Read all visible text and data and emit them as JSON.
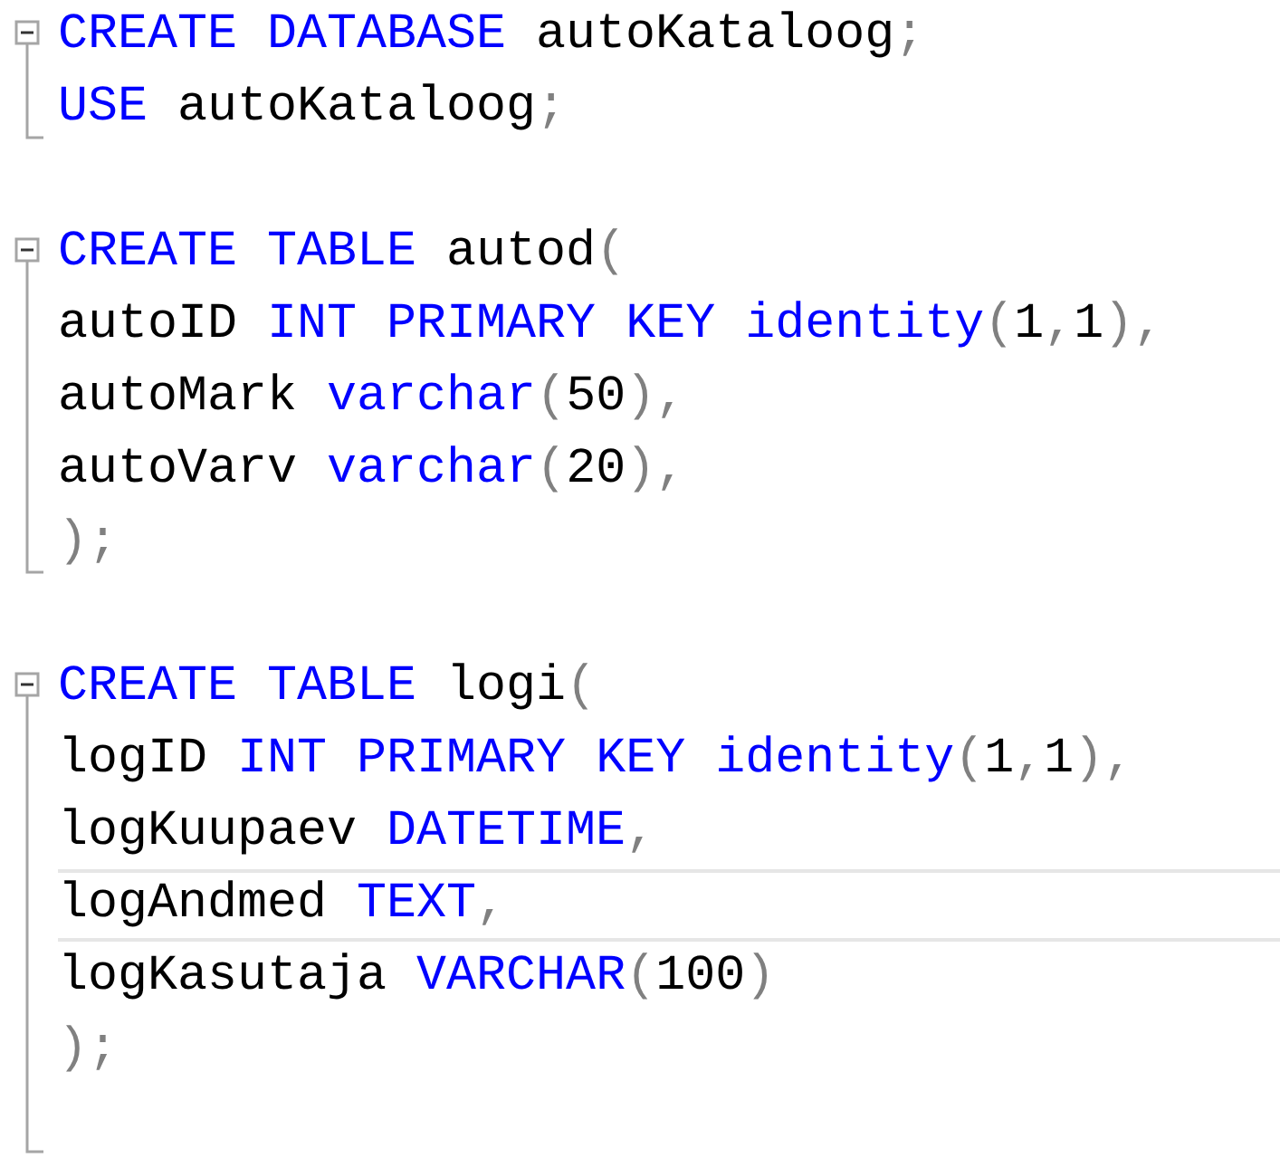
{
  "editor": {
    "lines": [
      {
        "kind": "start",
        "tokens": [
          {
            "text": "CREATE DATABASE",
            "kind": "keyword"
          },
          {
            "text": " autoKataloog",
            "kind": "ident"
          },
          {
            "text": ";",
            "kind": "punct"
          }
        ]
      },
      {
        "kind": "end",
        "tokens": [
          {
            "text": "USE",
            "kind": "keyword"
          },
          {
            "text": " autoKataloog",
            "kind": "ident"
          },
          {
            "text": ";",
            "kind": "punct"
          }
        ]
      },
      {
        "kind": "plain"
      },
      {
        "kind": "start",
        "tokens": [
          {
            "text": "CREATE TABLE",
            "kind": "keyword"
          },
          {
            "text": " autod",
            "kind": "ident"
          },
          {
            "text": "(",
            "kind": "punct"
          }
        ]
      },
      {
        "kind": "body",
        "tokens": [
          {
            "text": "autoID ",
            "kind": "ident"
          },
          {
            "text": "INT PRIMARY KEY identity",
            "kind": "keyword"
          },
          {
            "text": "(",
            "kind": "punct"
          },
          {
            "text": "1",
            "kind": "ident"
          },
          {
            "text": ",",
            "kind": "punct"
          },
          {
            "text": "1",
            "kind": "ident"
          },
          {
            "text": "),",
            "kind": "punct"
          }
        ]
      },
      {
        "kind": "body",
        "tokens": [
          {
            "text": "autoMark ",
            "kind": "ident"
          },
          {
            "text": "varchar",
            "kind": "keyword"
          },
          {
            "text": "(",
            "kind": "punct"
          },
          {
            "text": "50",
            "kind": "ident"
          },
          {
            "text": "),",
            "kind": "punct"
          }
        ]
      },
      {
        "kind": "body",
        "tokens": [
          {
            "text": "autoVarv ",
            "kind": "ident"
          },
          {
            "text": "varchar",
            "kind": "keyword"
          },
          {
            "text": "(",
            "kind": "punct"
          },
          {
            "text": "20",
            "kind": "ident"
          },
          {
            "text": "),",
            "kind": "punct"
          }
        ]
      },
      {
        "kind": "end",
        "tokens": [
          {
            "text": ");",
            "kind": "punct"
          }
        ]
      },
      {
        "kind": "plain"
      },
      {
        "kind": "start",
        "tokens": [
          {
            "text": "CREATE TABLE",
            "kind": "keyword"
          },
          {
            "text": " logi",
            "kind": "ident"
          },
          {
            "text": "(",
            "kind": "punct"
          }
        ]
      },
      {
        "kind": "body",
        "tokens": [
          {
            "text": "logID ",
            "kind": "ident"
          },
          {
            "text": "INT PRIMARY KEY identity",
            "kind": "keyword"
          },
          {
            "text": "(",
            "kind": "punct"
          },
          {
            "text": "1",
            "kind": "ident"
          },
          {
            "text": ",",
            "kind": "punct"
          },
          {
            "text": "1",
            "kind": "ident"
          },
          {
            "text": "),",
            "kind": "punct"
          }
        ]
      },
      {
        "kind": "body",
        "tokens": [
          {
            "text": "logKuupaev ",
            "kind": "ident"
          },
          {
            "text": "DATETIME",
            "kind": "keyword"
          },
          {
            "text": ",",
            "kind": "punct"
          }
        ]
      },
      {
        "kind": "body",
        "current": true,
        "tokens": [
          {
            "text": "logAndmed ",
            "kind": "ident"
          },
          {
            "text": "TEXT",
            "kind": "keyword"
          },
          {
            "text": ",",
            "kind": "punct"
          }
        ]
      },
      {
        "kind": "body",
        "tokens": [
          {
            "text": "logKasutaja ",
            "kind": "ident"
          },
          {
            "text": "VARCHAR",
            "kind": "keyword"
          },
          {
            "text": "(",
            "kind": "punct"
          },
          {
            "text": "100",
            "kind": "ident"
          },
          {
            "text": ")",
            "kind": "punct"
          }
        ]
      },
      {
        "kind": "body",
        "tokens": [
          {
            "text": ");",
            "kind": "punct"
          }
        ]
      },
      {
        "kind": "end"
      }
    ]
  }
}
